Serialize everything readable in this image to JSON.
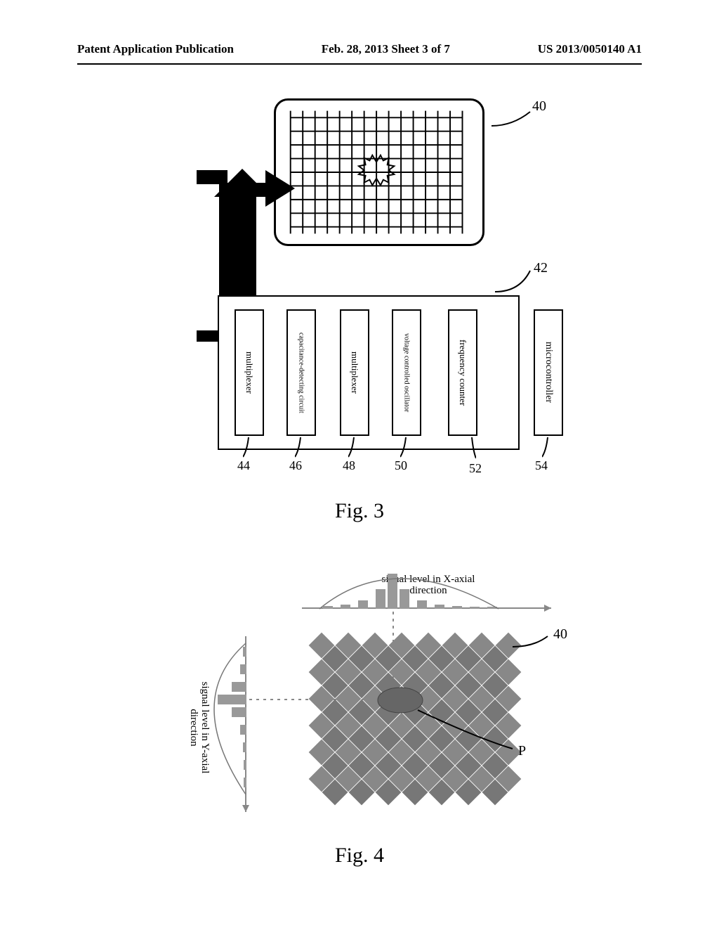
{
  "header": {
    "left": "Patent Application Publication",
    "center": "Feb. 28, 2013  Sheet 3 of 7",
    "right": "US 2013/0050140 A1"
  },
  "fig3": {
    "caption": "Fig. 3",
    "panel_ref": "40",
    "box_ref": "42",
    "blocks": {
      "b1": {
        "label": "multiplexer",
        "ref": "44"
      },
      "b2": {
        "label": "capacitance-detecting circuit",
        "ref": "46"
      },
      "b3": {
        "label": "multiplexer",
        "ref": "48"
      },
      "b4": {
        "label": "voltage controlled oscillator",
        "ref": "50"
      },
      "b5": {
        "label": "frequency counter",
        "ref": "52"
      },
      "micro": {
        "label": "microcontroller",
        "ref": "54"
      }
    }
  },
  "fig4": {
    "caption": "Fig. 4",
    "x_axis_label": "signal level in X-axial direction",
    "y_axis_label": "signal level in Y-axial direction",
    "panel_ref": "40",
    "point_ref": "P"
  }
}
